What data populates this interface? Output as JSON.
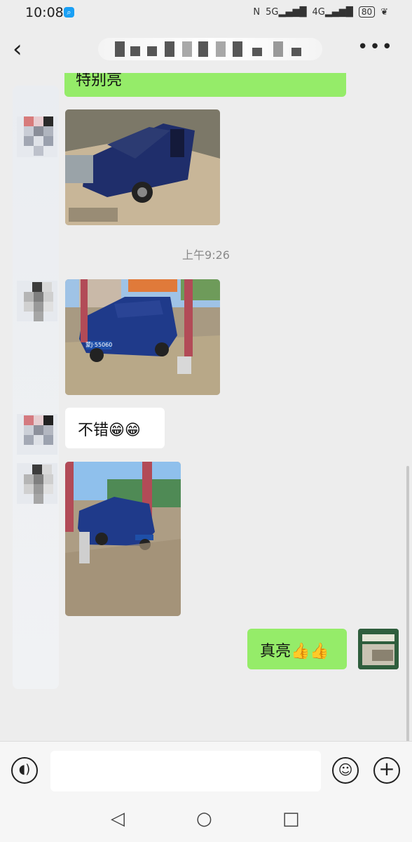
{
  "status_bar": {
    "time": "10:08",
    "badge_icon": "search-icon",
    "nfc": "N",
    "signal1": "5G",
    "signal2": "4G",
    "battery": "80"
  },
  "nav": {
    "back_icon": "chevron-left-icon",
    "more_icon": "more-icon"
  },
  "messages": {
    "top_partial_text": "特别亮",
    "timestamp": "上午9:26",
    "reply_text": "不错😁😁",
    "sent_text": "真亮👍👍",
    "plate_text": "蒙J·55060"
  },
  "input_bar": {
    "value": "",
    "voice_icon": "voice-icon",
    "emoji_icon": "emoji-icon",
    "plus_icon": "plus-icon"
  },
  "system_nav": {
    "back": "◁",
    "home": "○",
    "recents": "□"
  },
  "colors": {
    "sent_bubble": "#95ec69",
    "background": "#ededed",
    "car_blue": "#1f3a8a"
  }
}
